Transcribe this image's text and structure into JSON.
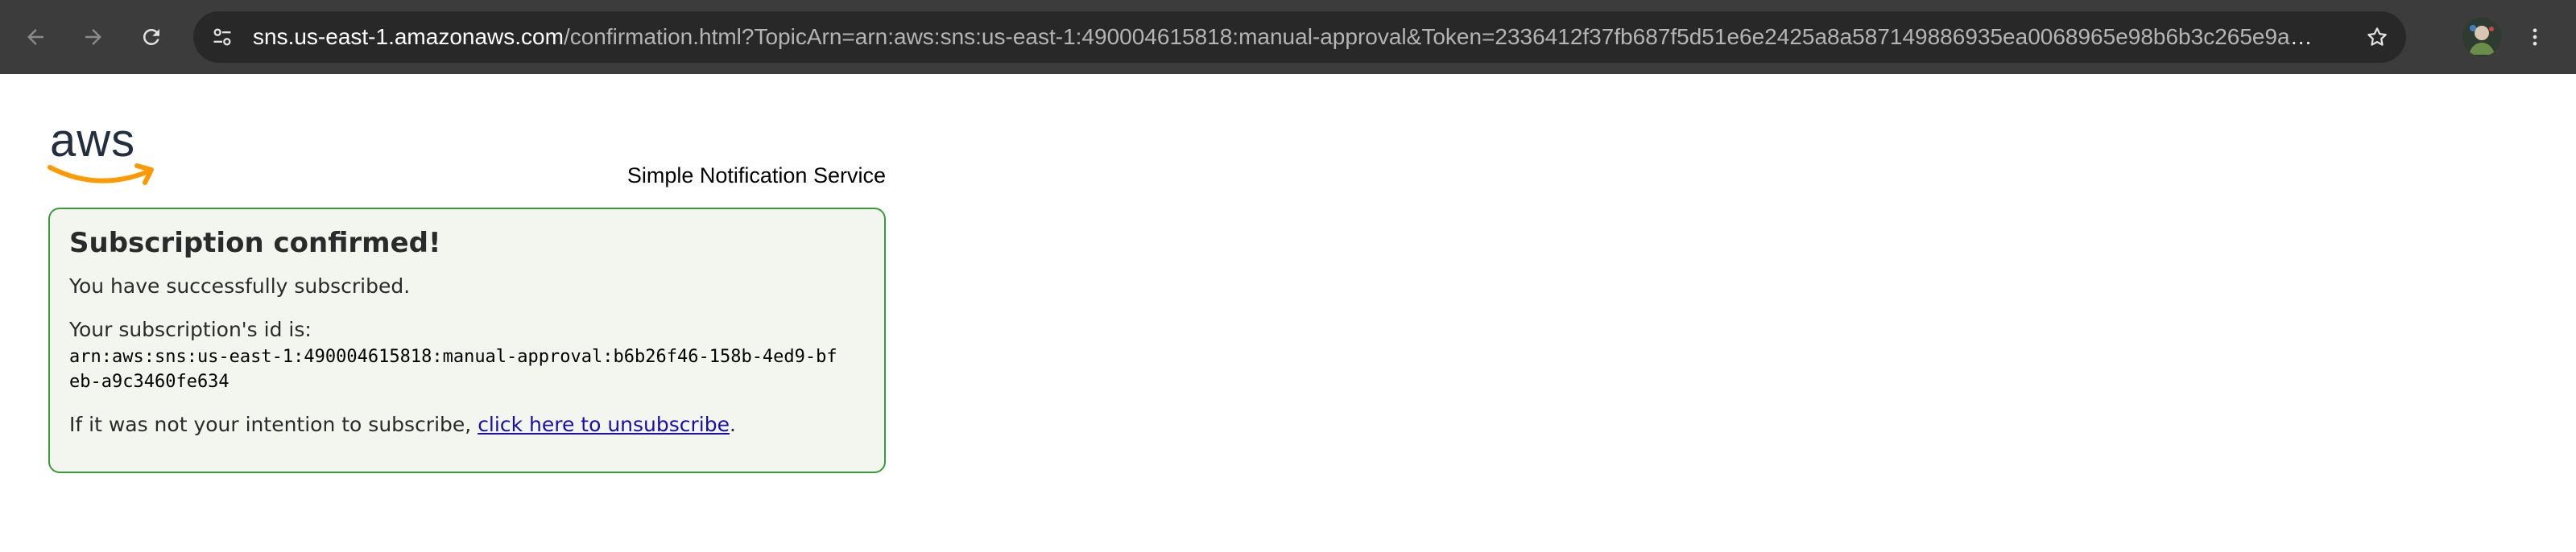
{
  "browser": {
    "url_host": "sns.us-east-1.amazonaws.com",
    "url_rest": "/confirmation.html?TopicArn=arn:aws:sns:us-east-1:490004615818:manual-approval&Token=2336412f37fb687f5d51e6e2425a8a587149886935ea0068965e98b6b3c265e9abb894a1b...",
    "icons": {
      "back": "arrow-left-icon",
      "forward": "arrow-right-icon",
      "reload": "reload-icon",
      "site_info": "tune-icon",
      "bookmark": "star-icon",
      "profile": "avatar",
      "menu": "kebab-menu-icon"
    }
  },
  "header": {
    "logo_text": "aws",
    "service_name": "Simple Notification Service"
  },
  "confirmation": {
    "title": "Subscription confirmed!",
    "message": "You have successfully subscribed.",
    "id_label": "Your subscription's id is:",
    "subscription_id": "arn:aws:sns:us-east-1:490004615818:manual-approval:b6b26f46-158b-4ed9-bfeb-a9c3460fe634",
    "unsub_prefix": "If it was not your intention to subscribe, ",
    "unsub_link": "click here to unsubscribe",
    "unsub_suffix": "."
  },
  "colors": {
    "toolbar_bg": "#3c3c3c",
    "omnibox_bg": "#282828",
    "panel_bg": "#f2f6ee",
    "panel_border": "#3b9a3b",
    "aws_orange": "#ff9900",
    "aws_text": "#232f3e",
    "link": "#1a0dab"
  }
}
